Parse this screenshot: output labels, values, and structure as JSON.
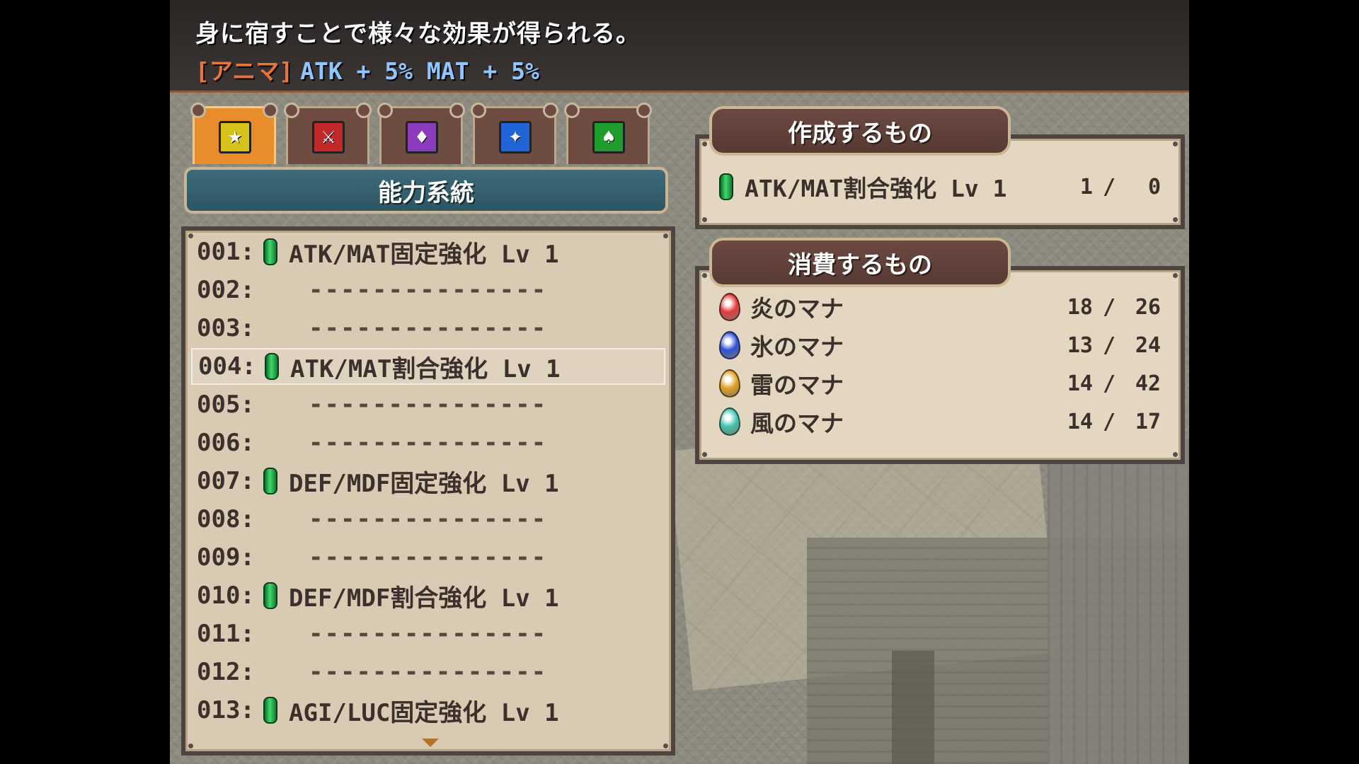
{
  "help": {
    "description": "身に宿すことで様々な効果が得られる。",
    "tag": "[アニマ]",
    "stats": "ATK + 5% MAT + 5%"
  },
  "tabs": [
    {
      "icon": "yellow-figure-icon",
      "color": "#d6c21a",
      "active": true
    },
    {
      "icon": "red-figure-icon",
      "color": "#c22a2a",
      "active": false
    },
    {
      "icon": "purple-figure-icon",
      "color": "#8c3bbd",
      "active": false
    },
    {
      "icon": "blue-figure-icon",
      "color": "#2064d8",
      "active": false
    },
    {
      "icon": "green-figure-icon",
      "color": "#1f9e2d",
      "active": false
    }
  ],
  "category_title": "能力系統",
  "list": [
    {
      "num": "001:",
      "name": "ATK/MAT固定強化 Lv 1",
      "empty": false
    },
    {
      "num": "002:",
      "name": "---------------",
      "empty": true
    },
    {
      "num": "003:",
      "name": "---------------",
      "empty": true
    },
    {
      "num": "004:",
      "name": "ATK/MAT割合強化 Lv 1",
      "empty": false,
      "selected": true
    },
    {
      "num": "005:",
      "name": "---------------",
      "empty": true
    },
    {
      "num": "006:",
      "name": "---------------",
      "empty": true
    },
    {
      "num": "007:",
      "name": "DEF/MDF固定強化 Lv 1",
      "empty": false
    },
    {
      "num": "008:",
      "name": "---------------",
      "empty": true
    },
    {
      "num": "009:",
      "name": "---------------",
      "empty": true
    },
    {
      "num": "010:",
      "name": "DEF/MDF割合強化 Lv 1",
      "empty": false
    },
    {
      "num": "011:",
      "name": "---------------",
      "empty": true
    },
    {
      "num": "012:",
      "name": "---------------",
      "empty": true
    },
    {
      "num": "013:",
      "name": "AGI/LUC固定強化 Lv 1",
      "empty": false
    }
  ],
  "create": {
    "title": "作成するもの",
    "item": {
      "name": "ATK/MAT割合強化 Lv 1",
      "have": "1",
      "need": "0"
    }
  },
  "consume": {
    "title": "消費するもの",
    "items": [
      {
        "name": "炎のマナ",
        "have": "18",
        "need": "26",
        "color": "#e23a3a"
      },
      {
        "name": "氷のマナ",
        "have": "13",
        "need": "24",
        "color": "#2f52d6"
      },
      {
        "name": "雷のマナ",
        "have": "14",
        "need": "42",
        "color": "#e0a020"
      },
      {
        "name": "風のマナ",
        "have": "14",
        "need": "17",
        "color": "#3fc4b0"
      }
    ]
  },
  "slash": "/"
}
